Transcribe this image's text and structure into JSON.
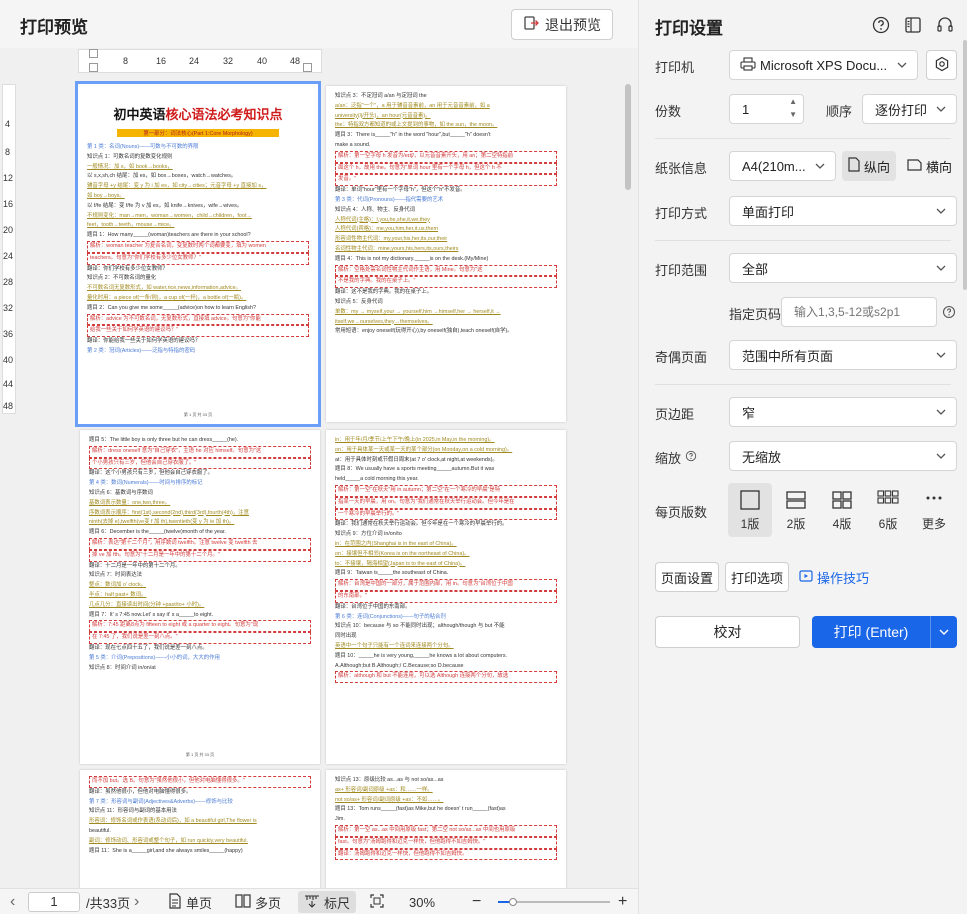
{
  "preview": {
    "title": "打印预览",
    "exit_label": "退出预览",
    "h_ruler_ticks": [
      "8",
      "16",
      "24",
      "32",
      "40",
      "48"
    ],
    "v_ruler_ticks": [
      "4",
      "8",
      "12",
      "16",
      "20",
      "24",
      "28",
      "32",
      "36",
      "40",
      "44",
      "48"
    ],
    "doc_title_plain": "初中英语",
    "doc_title_highlight": "核心语法必考知识点",
    "doc_subtitle": "第一部分：词法核心(Part 1:Core Morphology)",
    "pages": [
      {
        "lines": [
          {
            "t": "第 1 类：名词(Nouns)——可数与不可数的界限",
            "c": "blue"
          },
          {
            "t": "知识点 1：可数名词的复数变化规则",
            "c": ""
          },
          {
            "t": "一般情况：加 s，如 book→books，",
            "c": "olive"
          },
          {
            "t": "以 s,x,sh,ch 结尾：加 es，如 box→boxes，watch→watches。",
            "c": ""
          },
          {
            "t": "辅音字母 +y 结尾：变 y 为 i 加 es，如 city→cities；元音字母 +y 直接加 s，",
            "c": "olive"
          },
          {
            "t": "如 boy→boys。",
            "c": "olive"
          },
          {
            "t": "以 f/fe 结尾：变 f/fe 为 v 加 es，如 knife→knives，wife→wives。",
            "c": ""
          },
          {
            "t": "不规则变化：man→men，woman→women，child→children，foot→",
            "c": "olive"
          },
          {
            "t": "feet，tooth→teeth，mouse→mice。",
            "c": "olive"
          },
          {
            "t": "题目 1：How many_____(woman)teachers are there in your school?",
            "c": ""
          },
          {
            "t": "解析：woman teacher 为复合名词，变复数时两个词都要变，填为 women",
            "c": "red box"
          },
          {
            "t": "teachers。句意为\"你们学校有多少位女教师？\"",
            "c": "red box"
          },
          {
            "t": "翻译：你们学校有多少位女教师？",
            "c": ""
          },
          {
            "t": "知识点 2：不可数名词的量化",
            "c": ""
          },
          {
            "t": "不可数名词无复数形式，如 water,rice,news,information,advice。",
            "c": "olive"
          },
          {
            "t": "量化时用：a piece of(一条/则)，a cup of(一杯)，a bottle of(一瓶)。",
            "c": "olive"
          },
          {
            "t": "题目 2：Can you give me some_____(advice)on how to learn English?",
            "c": ""
          },
          {
            "t": "解析：advice 为不可数名词，无复数形式，直接填 advice。句意为\"你能",
            "c": "red box"
          },
          {
            "t": "给我一些关于如何学英语的建议吗？\"",
            "c": "red box"
          },
          {
            "t": "翻译：你能给我一些关于如何学英语的建议吗？",
            "c": ""
          },
          {
            "t": "第 2 类：冠词(Articles)——泛指与特指的密码",
            "c": "blue"
          }
        ]
      },
      {
        "lines": [
          {
            "t": "知识点 3：不定冠词 a/an 与定冠词 the",
            "c": ""
          },
          {
            "t": "a/an：泛指\"一个\"，a 用于辅音音素前，an 用于元音音素前，如 a",
            "c": "olive"
          },
          {
            "t": "university(/j/开头)，an hour(元音音素)。",
            "c": "olive"
          },
          {
            "t": "the：特指双方都知道的或上文提到的事物，如 the sun，the moon。",
            "c": "olive"
          },
          {
            "t": "题目 3：There is_____\"h\" in the word \"hour\",but_____\"h\" doesn't",
            "c": ""
          },
          {
            "t": "make a sound.",
            "c": ""
          },
          {
            "t": "解析：第一空字母 h 发音为/eɪtʃ/，以元音音素开头，用 an；第二空特指前",
            "c": "red box"
          },
          {
            "t": "面这个 h，故用 the。句意为\"单词 hour 里有一个字母 h，但这个 h 不",
            "c": "red box"
          },
          {
            "t": "发音。\"",
            "c": "red box"
          },
          {
            "t": "翻译：单词\"hour\"里有一个字母\"h\"，但这个\"h\"不发音。",
            "c": ""
          },
          {
            "t": "第 3 类：代词(Pronouns)——指代需要的艺术",
            "c": "blue"
          },
          {
            "t": "知识点 4：人称、物主、反身代词",
            "c": ""
          },
          {
            "t": "人称代词(主格)：I,you,he,she,it,we,they",
            "c": "olive"
          },
          {
            "t": "人称代词(宾格)：me,you,him,her,it,us,them",
            "c": "olive"
          },
          {
            "t": "形容词性物主代词：my,your,his,her,its,our,their",
            "c": "olive"
          },
          {
            "t": "名词性物主代词：mine,yours,his,hers,its,ours,theirs",
            "c": "olive"
          },
          {
            "t": "题目 4：This is not my dictionary._____is on the desk.(My/Mine)",
            "c": ""
          },
          {
            "t": "解析：空格处需名词性物主代词作主语，用 Mine。句意为\"这",
            "c": "red box"
          },
          {
            "t": "不是我的字典。我的在桌子上。\"",
            "c": "red box"
          },
          {
            "t": "翻译：这不是我的字典。我的在桌子上。",
            "c": ""
          },
          {
            "t": "知识点 5：反身代词",
            "c": ""
          },
          {
            "t": "单数：my → myself,your → yourself,him →himself,her → herself,it →",
            "c": "olive"
          },
          {
            "t": "itself,we→ourselves,they→themselves。",
            "c": "olive"
          },
          {
            "t": "常用短语：enjoy oneself(玩得开心),by oneself(独自),teach oneself(自学)。",
            "c": ""
          }
        ]
      },
      {
        "lines": [
          {
            "t": "题目 5：The little boy is only three but he can dress_____(he).",
            "c": ""
          },
          {
            "t": "解析：dress oneself 意为\"自己穿衣\"，主语 he 对应 himself。句意为\"这",
            "c": "red box"
          },
          {
            "t": "个小男孩只有三岁，但他会自己穿衣服了。\"",
            "c": "red box"
          },
          {
            "t": "翻译：这个小男孩只有三岁，但他会自己穿衣服了。",
            "c": ""
          },
          {
            "t": "第 4 类：数词(Numerals)——时间与排序的标记",
            "c": "blue"
          },
          {
            "t": "知识点 6：基数词与序数词",
            "c": ""
          },
          {
            "t": "基数词表示数量：one,two,three。",
            "c": "olive"
          },
          {
            "t": "序数词表示顺序：first(1st),second(2nd),third(3rd),fourth(4th)，注意",
            "c": "olive"
          },
          {
            "t": "ninth(去掉 e),twelfth(ve变 f 加 th),twentieth(变 y 为 ie 加 th)。",
            "c": "olive"
          },
          {
            "t": "题目 6：December is the_____(twelve)month of the year.",
            "c": ""
          },
          {
            "t": "解析：表达\"第十二个月\"，用序数词 twelfth。注意 twelve 变 twelfth 去",
            "c": "red box"
          },
          {
            "t": "掉 ve 加 fth。句意为\"十二月是一年中的第十二个月。\"",
            "c": "red box"
          },
          {
            "t": "翻译：十二月是一年中的第十二个月。",
            "c": ""
          },
          {
            "t": "知识点 7：时间表达法",
            "c": ""
          },
          {
            "t": "整点：数词加 o' clock。",
            "c": "olive"
          },
          {
            "t": "半点：half past+ 数词。",
            "c": "olive"
          },
          {
            "t": "几点几分：直接读出时间(分钟 +past/to+ 小时)。",
            "c": "olive"
          },
          {
            "t": "题目 7：It' s 7:45 now.Let' s say it' s a_____to eight.",
            "c": ""
          },
          {
            "t": "解析：7:45 距离8点为 fifteen to eight 或 a quarter to eight。句意为\"现",
            "c": "red box"
          },
          {
            "t": "在 7:45 了，我们说是差一刻八点。\"",
            "c": "red box"
          },
          {
            "t": "翻译：现在七点四十五了，我们说是差一刻八点。",
            "c": ""
          },
          {
            "t": "第 5 类：介词(Prepositions)——小小的词，大大的作用",
            "c": "blue"
          },
          {
            "t": "知识点 8：时间介词 in/on/at",
            "c": ""
          }
        ]
      },
      {
        "lines": [
          {
            "t": "in：用于年/月/季节/上午下午/晚上(in 2025,in May,in the morning)。",
            "c": "olive"
          },
          {
            "t": "on：用于具体某一天或某一天的某个部分(on Monday,on a cold morning)。",
            "c": "olive"
          },
          {
            "t": "at：用于具体时刻或节假日周末(at 7 o' clock,at night,at weekends)。",
            "c": ""
          },
          {
            "t": "题目 8：We usually have a sports meeting_____autumn.But it was",
            "c": ""
          },
          {
            "t": "held_____a cold morning this year.",
            "c": ""
          },
          {
            "t": "解析：第一空\"在秋天\"用 in autumn；第二空\"在一个寒冷的早晨\"是特",
            "c": "red box"
          },
          {
            "t": "指某一天的早晨，用 on。句意为\"我们通常在秋天举行运动会。但今年是在",
            "c": "red box"
          },
          {
            "t": "一个寒冷的早晨举行的。\"",
            "c": "red box"
          },
          {
            "t": "翻译：我们通常在秋天举行运动会。但今年是在一个寒冷的早晨举行的。",
            "c": ""
          },
          {
            "t": "知识点 9：方位介词 in/on/to",
            "c": ""
          },
          {
            "t": "in：在范围之内(Shanghai is in the east of China)。",
            "c": "olive"
          },
          {
            "t": "on：接壤但不相邻(Korea is on the northeast of China)。",
            "c": "olive"
          },
          {
            "t": "to：不接壤，隔海相望(Japan is to the east of China)。",
            "c": "olive"
          },
          {
            "t": "题目 9：Taiwan is_____the southeast of China.",
            "c": ""
          },
          {
            "t": "解析：台湾是中国的一部分，属于范围内部，用 in。句意为\"台湾位于中国",
            "c": "red box"
          },
          {
            "t": "的东南部。\"",
            "c": "red box"
          },
          {
            "t": "翻译：台湾位于中国的东南部。",
            "c": ""
          },
          {
            "t": "第 6 类：连词(Conjunctions)——句子的粘合剂",
            "c": "blue"
          },
          {
            "t": "知识点 10：because 与 so 不能同时出现；although/though 与 but 不能",
            "c": ""
          },
          {
            "t": "同时出现",
            "c": ""
          },
          {
            "t": "英语中一个句子只能有一个连词来连接两个分句。",
            "c": "olive"
          },
          {
            "t": "题目 10：_____he is very young,_____he knows a lot about computers.",
            "c": ""
          },
          {
            "t": "A.Although;but B.Although;/ C.Because;so D.because",
            "c": ""
          },
          {
            "t": "解析：although 和 but 不能连用，可以选 Although 连接两个分句，故选",
            "c": "red box"
          }
        ]
      },
      {
        "lines": [
          {
            "t": "而不加 but。选 B。句意为\"虽然他很小，但他对电脑懂得很多。\"",
            "c": "red box"
          },
          {
            "t": "翻译：虽然他很小，但他对电脑懂得很多。",
            "c": ""
          },
          {
            "t": "第 7 类：形容词与副词(Adjectives&Adverbs)——修饰与比较",
            "c": "blue"
          },
          {
            "t": "知识点 11：形容词与副词的基本用法",
            "c": ""
          },
          {
            "t": "形容词：修饰名词或作表语(系动词后)，如 a beautiful girl,The flower is",
            "c": "olive"
          },
          {
            "t": "beautiful.",
            "c": ""
          },
          {
            "t": "副词：修饰动词、形容词或整个句子，如 run quickly,very beautiful.",
            "c": "olive"
          },
          {
            "t": "题目 11：She is a_____girl,and she always smiles_____(happy)",
            "c": ""
          }
        ]
      },
      {
        "lines": [
          {
            "t": "知识点 13：原级比较 as...as 与 not so/as...as",
            "c": ""
          },
          {
            "t": "as+ 形容词/副词原级 +as：和……一样。",
            "c": "olive"
          },
          {
            "t": "not so/as+ 形容词/副词原级 +as：不如……。",
            "c": "olive"
          },
          {
            "t": "题目 13：Tom runs_____(fast)as Mike,but he doesn' t run_____(fast)as",
            "c": ""
          },
          {
            "t": "Jim.",
            "c": ""
          },
          {
            "t": "解析：第一空 as...as 中间用原级 fast；第二空 not so/as...as 中间也用原级",
            "c": "red box"
          },
          {
            "t": "fast。句意为\"汤姆跑得和迈克一样快，但他跑得不如吉姆快。\"",
            "c": "red box"
          },
          {
            "t": "翻译：汤姆跑得和迈克一样快，但他跑得不如吉姆快。",
            "c": "red box"
          }
        ]
      }
    ],
    "page_footer": "第 1 页 共 33 页"
  },
  "bottom_bar": {
    "page_value": "1",
    "total_pages": "/共33页",
    "single_label": "单页",
    "multi_label": "多页",
    "ruler_label": "标尺",
    "zoom_value": "30%",
    "zoom_fraction": 0.3
  },
  "settings": {
    "title": "打印设置",
    "printer_label": "打印机",
    "printer_value": "Microsoft XPS Docu...",
    "copies_label": "份数",
    "copies_value": "1",
    "order_label": "顺序",
    "order_value": "逐份打印",
    "paper_label": "纸张信息",
    "paper_value": "A4(210m...",
    "portrait_label": "纵向",
    "landscape_label": "横向",
    "mode_label": "打印方式",
    "mode_value": "单面打印",
    "range_label": "打印范围",
    "range_value": "全部",
    "pages_label": "指定页码",
    "pages_placeholder": "输入1,3,5-12或s2p1",
    "odd_even_label": "奇偶页面",
    "odd_even_value": "范围中所有页面",
    "margin_label": "页边距",
    "margin_value": "窄",
    "scale_label": "缩放",
    "scale_value": "无缩放",
    "per_sheet_label": "每页版数",
    "layouts": [
      "1版",
      "2版",
      "4版",
      "6版",
      "更多"
    ],
    "page_setup_label": "页面设置",
    "print_options_label": "打印选项",
    "tips_label": "操作技巧",
    "proofread_label": "校对",
    "print_label": "打印 (Enter)"
  },
  "colors": {
    "accent": "#1a66e8",
    "selected_outline": "#6b9ef7",
    "red_text": "#d23c3c"
  }
}
